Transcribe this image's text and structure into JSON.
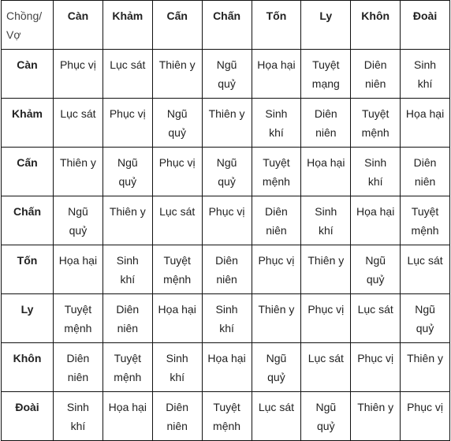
{
  "table": {
    "corner": "Chồng/ Vợ",
    "columns": [
      "Càn",
      "Khảm",
      "Cấn",
      "Chấn",
      "Tốn",
      "Ly",
      "Khôn",
      "Đoài"
    ],
    "rows": [
      {
        "label": "Càn",
        "cells": [
          "Phục vị",
          "Lục sát",
          "Thiên y",
          "Ngũ quỷ",
          "Họa hại",
          "Tuyệt mạng",
          "Diên niên",
          "Sinh khí"
        ]
      },
      {
        "label": "Khảm",
        "cells": [
          "Lục sát",
          "Phục vị",
          "Ngũ quỷ",
          "Thiên y",
          "Sinh khí",
          "Diên niên",
          "Tuyệt mệnh",
          "Họa hại"
        ]
      },
      {
        "label": "Cấn",
        "cells": [
          "Thiên y",
          "Ngũ quỷ",
          "Phục vị",
          "Ngũ quỷ",
          "Tuyệt mệnh",
          "Họa hại",
          "Sinh khí",
          "Diên niên"
        ]
      },
      {
        "label": "Chấn",
        "cells": [
          "Ngũ quỷ",
          "Thiên y",
          "Lục sát",
          "Phục vị",
          "Diên niên",
          "Sinh khí",
          "Họa hại",
          "Tuyệt mệnh"
        ]
      },
      {
        "label": "Tốn",
        "cells": [
          "Họa hại",
          "Sinh khí",
          "Tuyệt mệnh",
          "Diên niên",
          "Phục vị",
          "Thiên y",
          "Ngũ quỷ",
          "Lục sát"
        ]
      },
      {
        "label": "Ly",
        "cells": [
          "Tuyệt mệnh",
          "Diên niên",
          "Họa hại",
          "Sinh khí",
          "Thiên y",
          "Phục vị",
          "Lục sát",
          "Ngũ quỷ"
        ]
      },
      {
        "label": "Khôn",
        "cells": [
          "Diên niên",
          "Tuyệt mệnh",
          "Sinh khí",
          "Họa hại",
          "Ngũ quỷ",
          "Lục sát",
          "Phục vị",
          "Thiên y"
        ]
      },
      {
        "label": "Đoài",
        "cells": [
          "Sinh khí",
          "Họa hại",
          "Diên niên",
          "Tuyệt mệnh",
          "Lục sát",
          "Ngũ quỷ",
          "Thiên y",
          "Phục vị"
        ]
      }
    ]
  }
}
